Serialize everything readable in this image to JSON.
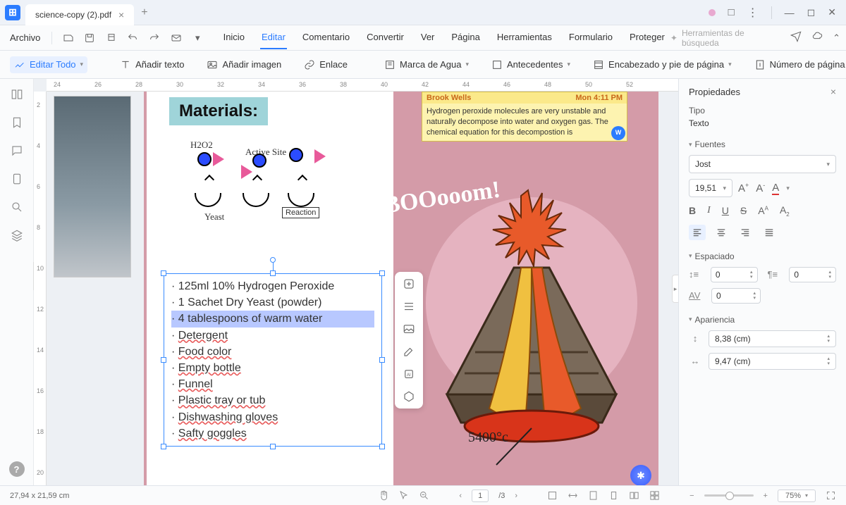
{
  "titlebar": {
    "tab_title": "science-copy (2).pdf"
  },
  "menu": {
    "file": "Archivo",
    "tabs": {
      "home": "Inicio",
      "edit": "Editar",
      "comment": "Comentario",
      "convert": "Convertir",
      "view": "Ver",
      "page": "Página",
      "tools": "Herramientas",
      "form": "Formulario",
      "protect": "Proteger"
    },
    "search_tools": "Herramientas de búsqueda"
  },
  "toolbar": {
    "edit_all": "Editar Todo",
    "add_text": "Añadir texto",
    "add_image": "Añadir imagen",
    "link": "Enlace",
    "watermark": "Marca de Agua",
    "background": "Antecedentes",
    "header_footer": "Encabezado y pie de página",
    "page_number": "Número de página"
  },
  "ruler": {
    "h": [
      "24",
      "26",
      "28",
      "30",
      "32",
      "34",
      "36",
      "38",
      "40",
      "42",
      "44",
      "46",
      "48",
      "50",
      "52"
    ],
    "v": [
      "2",
      "4",
      "6",
      "8",
      "10",
      "12",
      "14",
      "16",
      "18",
      "20"
    ]
  },
  "page": {
    "materials_title": "Materials:",
    "diagram": {
      "h2o2": "H2O2",
      "active_site": "Active Site",
      "yeast": "Yeast",
      "reaction": "Reaction"
    },
    "list": [
      "125ml 10% Hydrogen Peroxide",
      "1 Sachet Dry Yeast (powder)",
      "4 tablespoons of warm water",
      "Detergent",
      "Food color",
      "Empty bottle",
      "Funnel",
      "Plastic tray or tub",
      "Dishwashing gloves",
      "Safty goggles"
    ],
    "comment": {
      "author": "Brook Wells",
      "time": "Mon 4:11 PM",
      "body": "Hydrogen peroxide molecules are very unstable and naturally decompose into water and oxygen gas. The chemical equation for this decompostion is"
    },
    "boom": "BOOooom!",
    "temperature": "5400°c"
  },
  "props": {
    "title": "Propiedades",
    "type_label": "Tipo",
    "type_value": "Texto",
    "fonts_label": "Fuentes",
    "font_family": "Jost",
    "font_size": "19,51",
    "spacing_label": "Espaciado",
    "spacing_before": "0",
    "spacing_after": "0",
    "char_spacing": "0",
    "appearance_label": "Apariencia",
    "width": "8,38 (cm)",
    "height": "9,47 (cm)"
  },
  "statusbar": {
    "dims": "27,94 x 21,59 cm",
    "page_current": "1",
    "page_total": "/3",
    "zoom": "75%"
  }
}
